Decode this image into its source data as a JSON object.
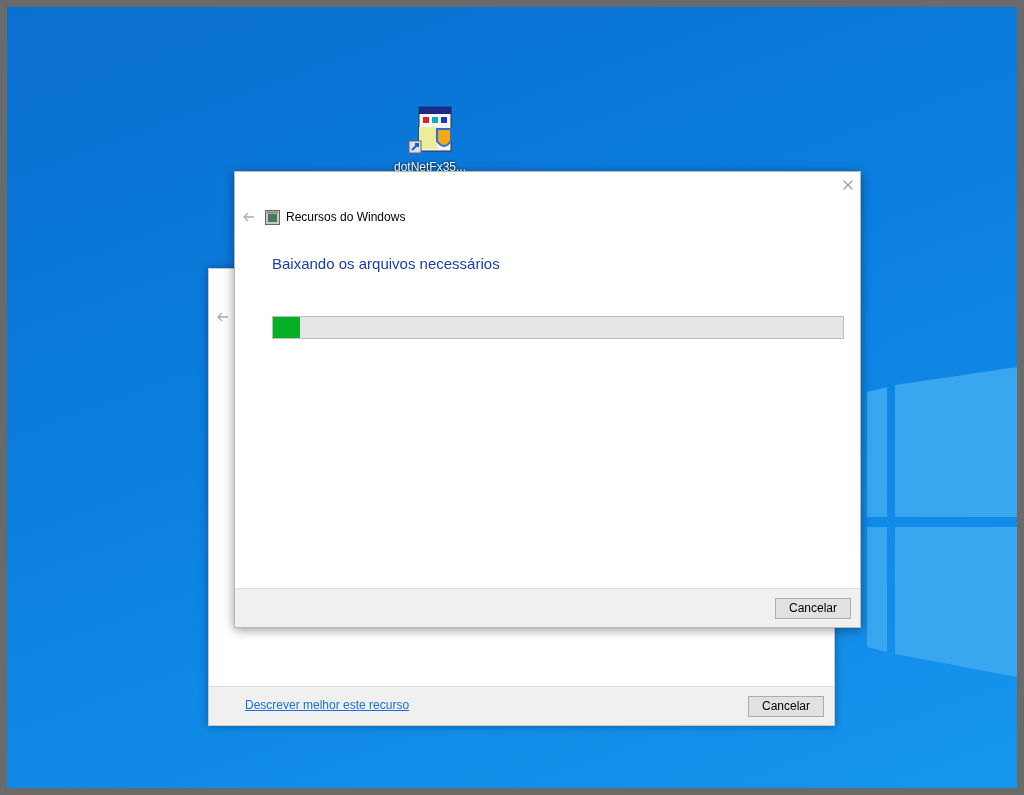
{
  "desktop": {
    "icons": [
      {
        "label": "dotNetFx35..."
      }
    ]
  },
  "back_dialog": {
    "link": "Descrever melhor este recurso",
    "buttons": [
      "Cancelar"
    ]
  },
  "dialog": {
    "title": "Recursos do Windows",
    "heading": "Baixando os arquivos necessários",
    "progress": {
      "level": 0.047
    },
    "buttons": [
      "Cancelar"
    ]
  }
}
